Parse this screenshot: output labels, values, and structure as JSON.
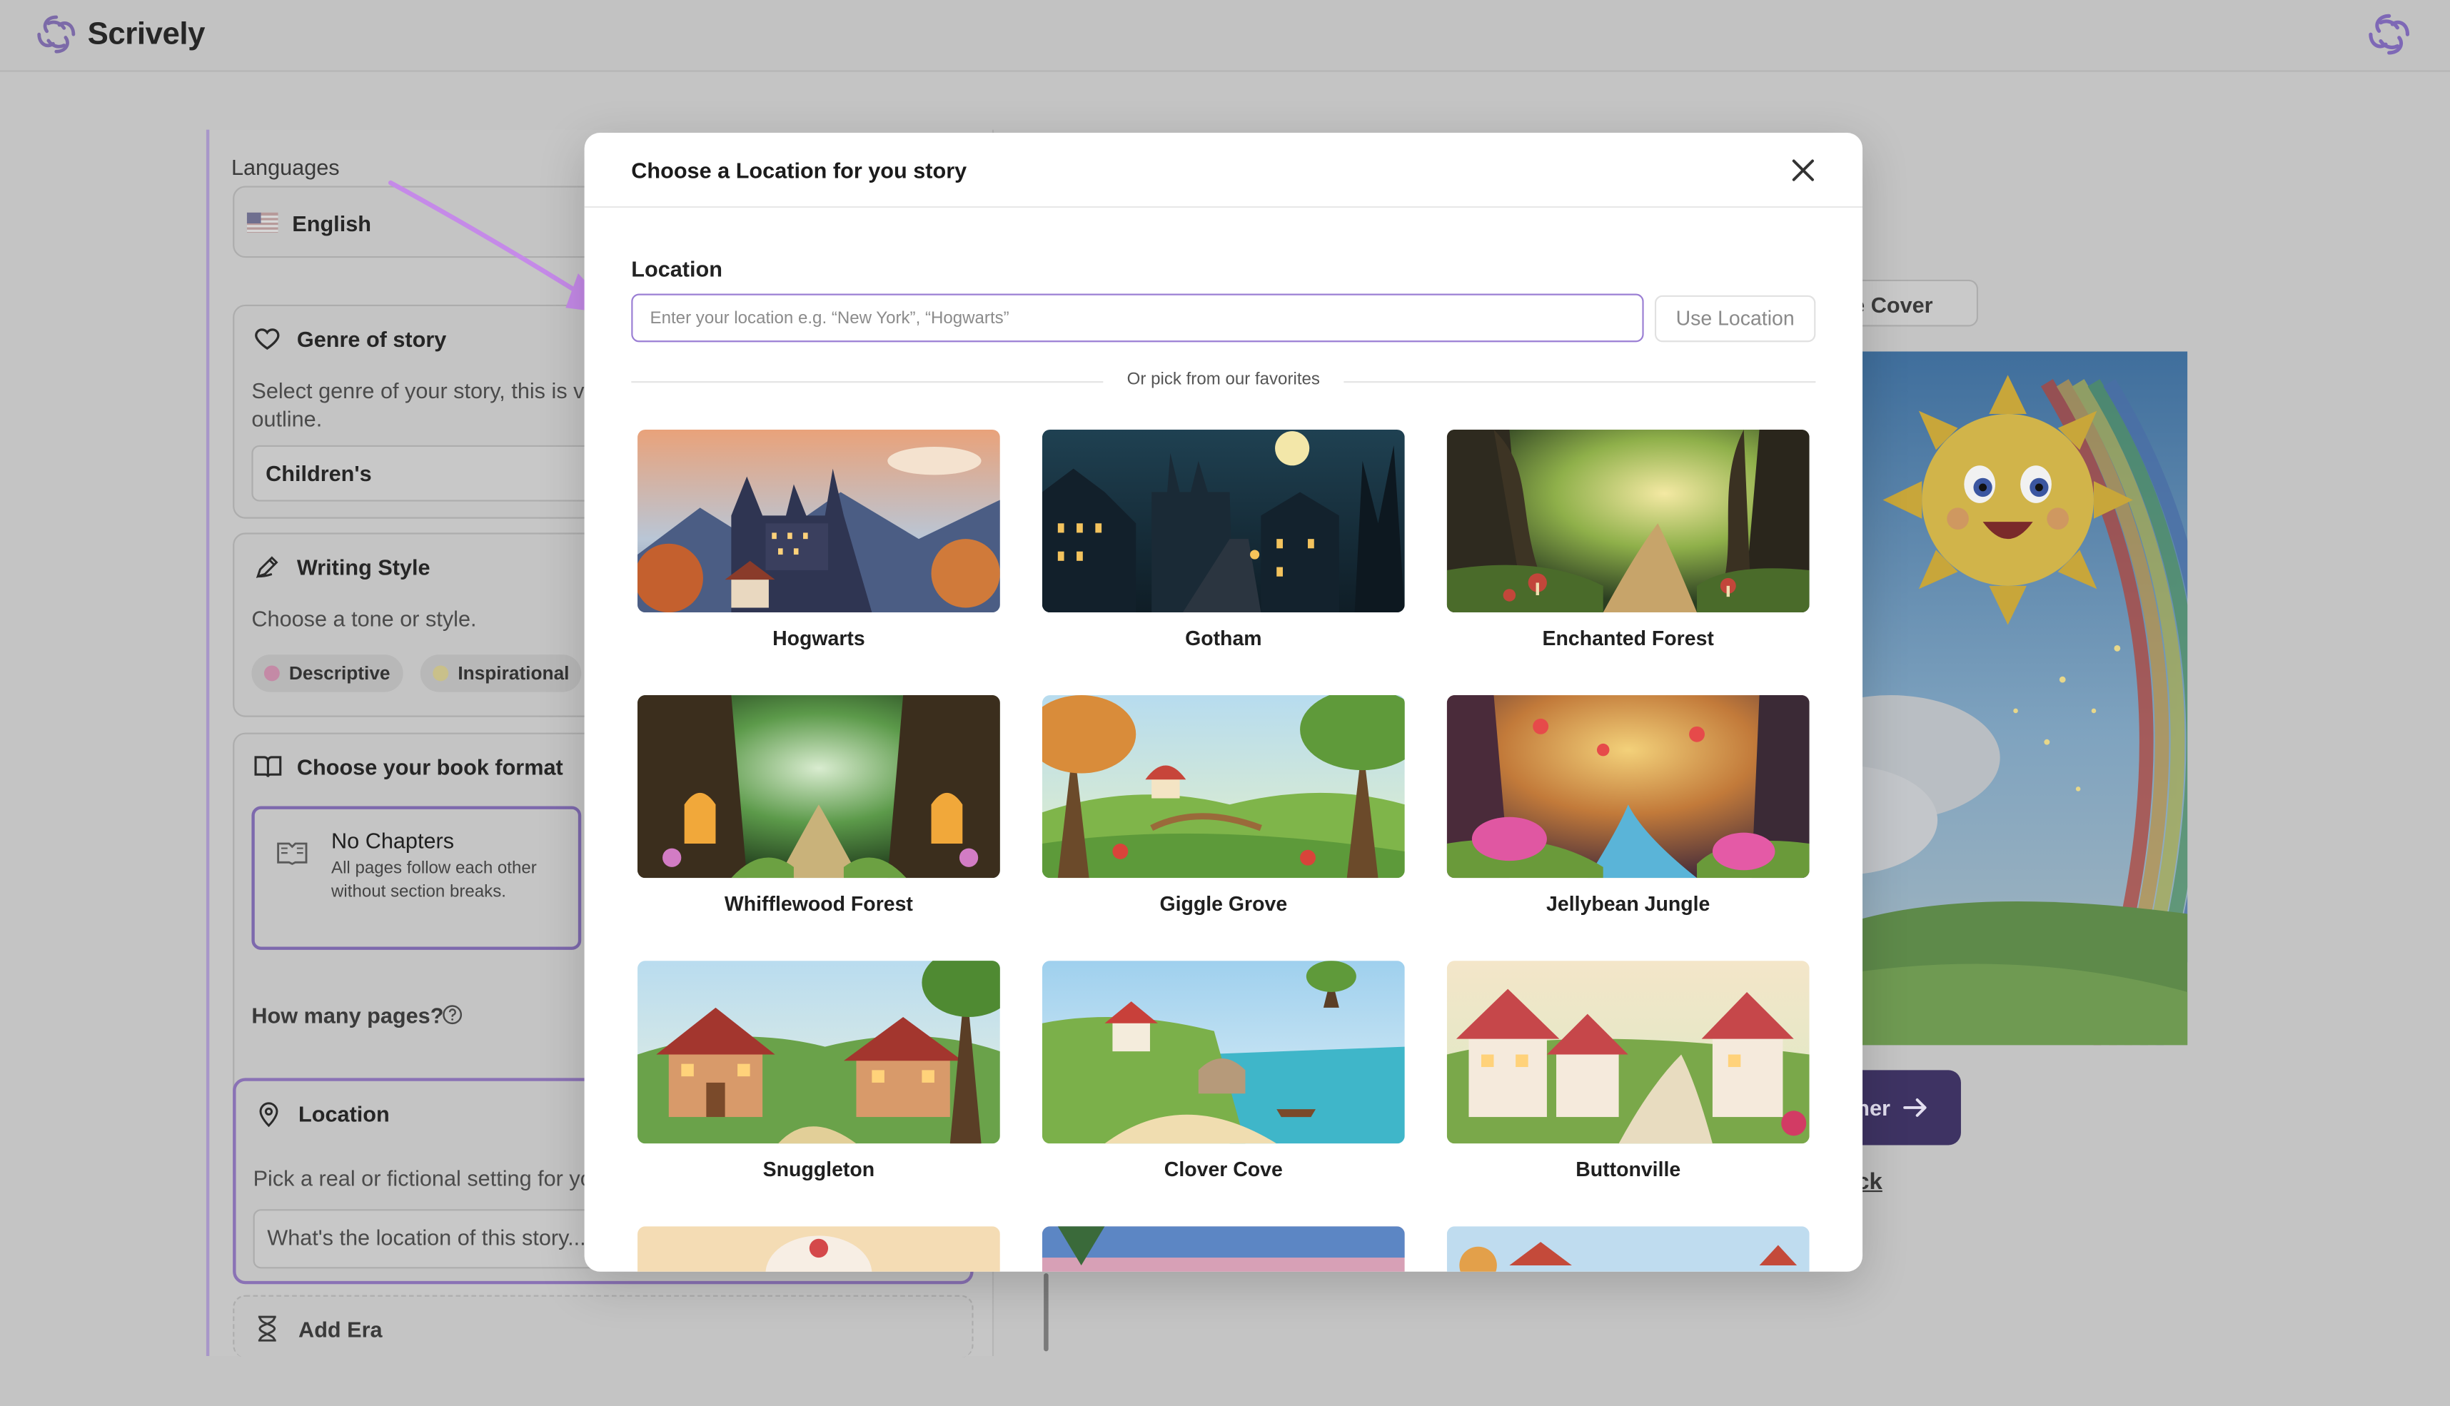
{
  "app": {
    "name": "Scrively",
    "accent": "#7c5cc4"
  },
  "left_panel": {
    "languages_label": "Languages",
    "language_value": "English",
    "genre": {
      "title": "Genre of story",
      "desc_line1": "Select genre of your story, this is ve",
      "desc_line2": "outline.",
      "value": "Children's"
    },
    "writing_style": {
      "title": "Writing Style",
      "desc": "Choose a tone or style.",
      "chips": [
        "Descriptive",
        "Inspirational"
      ]
    },
    "book_format": {
      "title": "Choose your book format",
      "option_title": "No Chapters",
      "option_desc_line1": "All pages follow each other",
      "option_desc_line2": "without section breaks."
    },
    "pages_label": "How many pages?",
    "location": {
      "title": "Location",
      "desc": "Pick a real or fictional setting for yo",
      "placeholder": "What's the location of this story..."
    },
    "era_label": "Add Era"
  },
  "right_area": {
    "cover_button": "te Cover",
    "next_button": "ner",
    "back_link": "ck"
  },
  "modal": {
    "title": "Choose a Location for you story",
    "location_label": "Location",
    "input_placeholder": "Enter your location e.g. “New York”, “Hogwarts”",
    "input_value": "",
    "use_button": "Use Location",
    "or_text": "Or pick from our favorites",
    "favorites": [
      {
        "name": "Hogwarts"
      },
      {
        "name": "Gotham"
      },
      {
        "name": "Enchanted Forest"
      },
      {
        "name": "Whifflewood Forest"
      },
      {
        "name": "Giggle Grove"
      },
      {
        "name": "Jellybean Jungle"
      },
      {
        "name": "Snuggleton"
      },
      {
        "name": "Clover Cove"
      },
      {
        "name": "Buttonville"
      }
    ]
  }
}
